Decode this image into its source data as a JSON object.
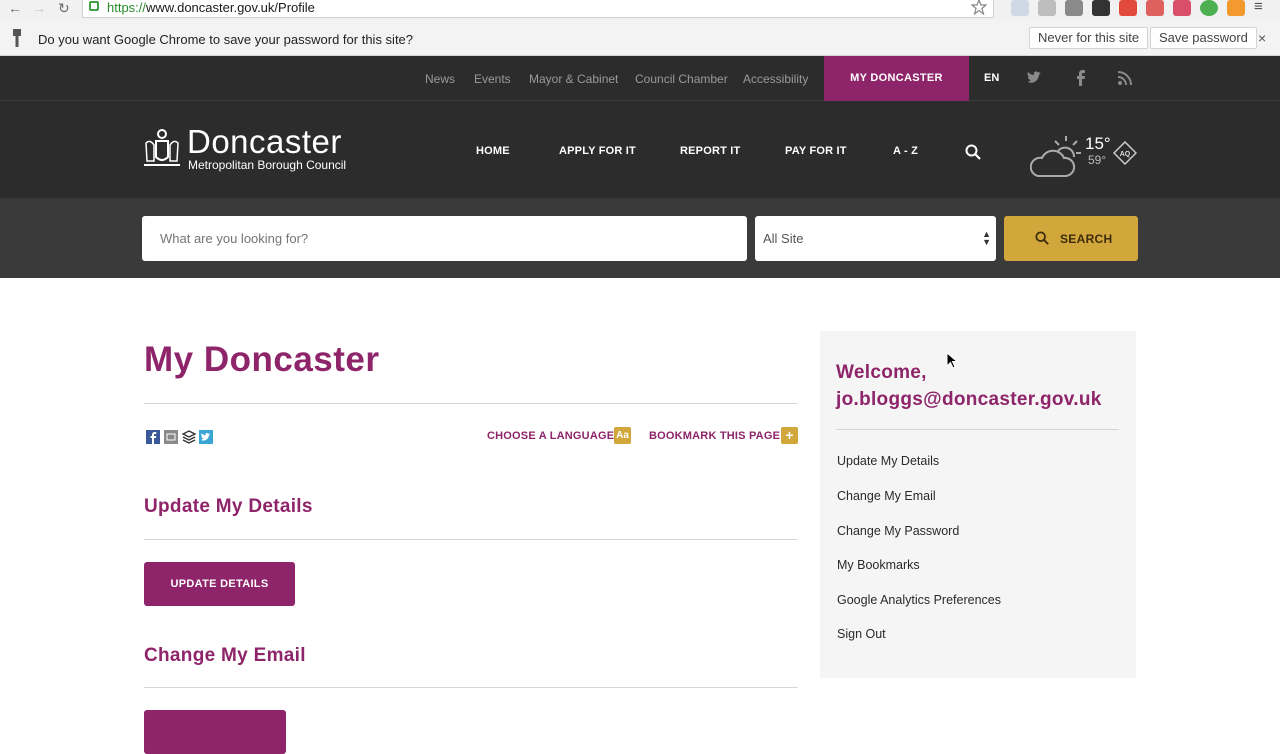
{
  "browser": {
    "url_scheme": "https://",
    "url_rest": "www.doncaster.gov.uk/Profile",
    "password_prompt": "Do you want Google Chrome to save your password for this site?",
    "never_label": "Never for this site",
    "save_label": "Save password",
    "close_glyph": "×",
    "back_glyph": "←",
    "forward_glyph": "→",
    "reload_glyph": "↻"
  },
  "utility_nav": {
    "items": [
      "News",
      "Events",
      "Mayor & Cabinet",
      "Council Chamber",
      "Accessibility"
    ],
    "my_doncaster": "MY DONCASTER",
    "language": "EN",
    "accent": "#8e2469"
  },
  "logo": {
    "name": "Doncaster",
    "subtitle": "Metropolitan Borough Council"
  },
  "main_nav": [
    "HOME",
    "APPLY FOR IT",
    "REPORT IT",
    "PAY FOR IT",
    "A - Z"
  ],
  "weather": {
    "temp_c": "15°",
    "temp_f": "59°",
    "aq_label": "AQ"
  },
  "search": {
    "placeholder": "What are you looking for?",
    "scope": "All Site",
    "button": "SEARCH",
    "button_color": "#d1a63a"
  },
  "content": {
    "title": "My Doncaster",
    "choose_language": "CHOOSE A LANGUAGE",
    "language_badge": "Aa",
    "bookmark": "BOOKMARK THIS PAGE",
    "bookmark_badge": "+",
    "sections": [
      {
        "heading": "Update My Details",
        "button": "UPDATE DETAILS"
      },
      {
        "heading": "Change My Email",
        "button": ""
      }
    ]
  },
  "sidebar": {
    "welcome_line1": "Welcome,",
    "welcome_line2": "jo.bloggs@doncaster.gov.uk",
    "links": [
      "Update My Details",
      "Change My Email",
      "Change My Password",
      "My Bookmarks",
      "Google Analytics Preferences",
      "Sign Out"
    ]
  }
}
